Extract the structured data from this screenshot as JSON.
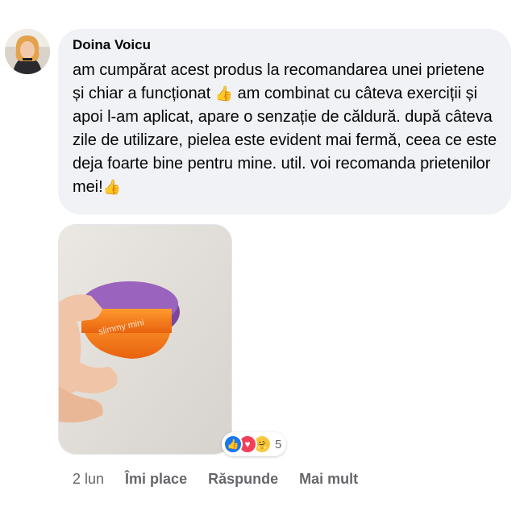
{
  "comment": {
    "author": "Doina Voicu",
    "text_parts": [
      "am cumpărat acest produs la recomandarea unei prietene și chiar a funcționat ",
      " am combinat cu câteva exerciții și apoi l-am aplicat, apare o senzație de căldură. după câteva zile de utilizare, pielea este evident mai fermă, ceea ce este deja foarte bine pentru mine. util. voi recomanda prietenilor mei!"
    ],
    "emoji": "👍",
    "photo": {
      "jar_label": "slimmy mini"
    },
    "reactions": {
      "icons": [
        "like-icon",
        "love-icon",
        "care-icon"
      ],
      "count": "5"
    },
    "actions": {
      "time": "2 lun",
      "like": "Îmi place",
      "reply": "Răspunde",
      "more": "Mai mult"
    }
  },
  "colors": {
    "bubble": "#f0f2f5",
    "secondary_text": "#65676b",
    "like_blue": "#1877f2",
    "love_red": "#f33e58",
    "jar_orange": "#f27a1a",
    "lid_purple": "#8e57b0"
  }
}
